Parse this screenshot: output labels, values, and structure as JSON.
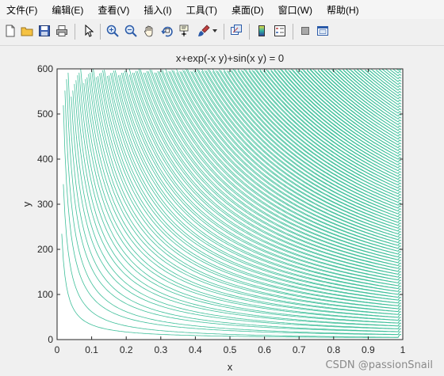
{
  "menubar": {
    "items": [
      "文件(F)",
      "编辑(E)",
      "查看(V)",
      "插入(I)",
      "工具(T)",
      "桌面(D)",
      "窗口(W)",
      "帮助(H)"
    ]
  },
  "toolbar": {
    "buttons": [
      "new-figure-icon",
      "open-icon",
      "save-icon",
      "print-icon",
      "pointer-icon",
      "zoom-in-icon",
      "zoom-out-icon",
      "pan-icon",
      "rotate-3d-icon",
      "data-cursor-icon",
      "brush-icon",
      "link-plot-icon",
      "colorbar-icon",
      "legend-icon",
      "hide-plot-tools-icon",
      "show-plot-tools-icon"
    ]
  },
  "chart_data": {
    "type": "contour",
    "title": "x+exp(-x y)+sin(x y) = 0",
    "xlabel": "x",
    "ylabel": "y",
    "xlim": [
      0,
      1
    ],
    "ylim": [
      0,
      600
    ],
    "xticks": [
      "0",
      "0.1",
      "0.2",
      "0.3",
      "0.4",
      "0.5",
      "0.6",
      "0.7",
      "0.8",
      "0.9",
      "1"
    ],
    "yticks": [
      "0",
      "100",
      "200",
      "300",
      "400",
      "500",
      "600"
    ],
    "line_color": "#3fbf9a",
    "grid": false
  },
  "watermark": "CSDN @passionSnail"
}
